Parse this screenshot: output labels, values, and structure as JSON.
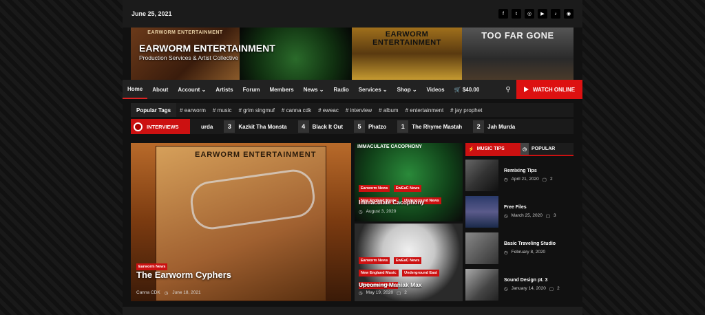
{
  "topbar": {
    "date": "June 25, 2021",
    "socials": [
      {
        "icon": "facebook-icon",
        "glyph": "f"
      },
      {
        "icon": "twitter-icon",
        "glyph": "t"
      },
      {
        "icon": "instagram-icon",
        "glyph": "◎"
      },
      {
        "icon": "youtube-icon",
        "glyph": "▶"
      },
      {
        "icon": "tiktok-icon",
        "glyph": "♪"
      },
      {
        "icon": "spotify-icon",
        "glyph": "◉"
      }
    ]
  },
  "banner": {
    "title": "EARWORM ENTERTAINMENT",
    "tagline": "Production Services & Artist Collective",
    "images": [
      {
        "caption": "EARWORM ENTERTAINMENT"
      },
      {
        "caption": ""
      },
      {
        "caption": "EARWORM ENTERTAINMENT"
      },
      {
        "caption": "TOO FAR GONE"
      }
    ]
  },
  "nav": {
    "items": [
      {
        "label": "Home",
        "dropdown": false
      },
      {
        "label": "About",
        "dropdown": false
      },
      {
        "label": "Account",
        "dropdown": true
      },
      {
        "label": "Artists",
        "dropdown": false
      },
      {
        "label": "Forum",
        "dropdown": false
      },
      {
        "label": "Members",
        "dropdown": false
      },
      {
        "label": "News",
        "dropdown": true
      },
      {
        "label": "Radio",
        "dropdown": false
      },
      {
        "label": "Services",
        "dropdown": true
      },
      {
        "label": "Shop",
        "dropdown": true
      },
      {
        "label": "Videos",
        "dropdown": false
      }
    ],
    "cart": "$40.00",
    "watch_label": "WATCH ONLINE"
  },
  "tags": {
    "label": "Popular Tags",
    "items": [
      "earworm",
      "music",
      "grim singmuf",
      "canna cdk",
      "eweac",
      "interview",
      "album",
      "entertainment",
      "jay prophet"
    ]
  },
  "ticker": {
    "label": "INTERVIEWS",
    "items": [
      {
        "num": "",
        "title": "urda"
      },
      {
        "num": "3",
        "title": "Kazkit Tha Monsta"
      },
      {
        "num": "4",
        "title": "Black It Out"
      },
      {
        "num": "5",
        "title": "Phatzo"
      },
      {
        "num": "1",
        "title": "The Rhyme Mastah"
      },
      {
        "num": "2",
        "title": "Jah Murda"
      }
    ]
  },
  "feature": {
    "poster_title": "EARWORM ENTERTAINMENT",
    "category": "Earworm News",
    "title": "The Earworm Cyphers",
    "author": "Canna CDK",
    "date": "June 18, 2021"
  },
  "cards": [
    {
      "top": "IMMACULATE CACOPHONY",
      "categories": [
        "Earworm News",
        "EwEaC News",
        "New England Music",
        "Underground News"
      ],
      "title": "Immaculate Cacophony",
      "date": "August 3, 2020",
      "comments": ""
    },
    {
      "top": "",
      "categories": [
        "Earworm News",
        "EwEaC News",
        "New England Music",
        "Underground East",
        "Underground News"
      ],
      "title": "Upcoming Maniak Max",
      "date": "May 19, 2020",
      "comments": "2"
    }
  ],
  "sidebar": {
    "tab_music": "MUSIC TIPS",
    "tab_popular": "POPULAR",
    "items": [
      {
        "title": "Remixing Tips",
        "date": "April 21, 2020",
        "comments": "2"
      },
      {
        "title": "Free Files",
        "date": "March 25, 2020",
        "comments": "3"
      },
      {
        "title": "Basic Traveling Studio",
        "date": "February 8, 2020",
        "comments": ""
      },
      {
        "title": "Sound Design pt. 3",
        "date": "January 14, 2020",
        "comments": "2"
      }
    ]
  },
  "colors": {
    "accent": "#cc1111",
    "background": "#111111"
  }
}
